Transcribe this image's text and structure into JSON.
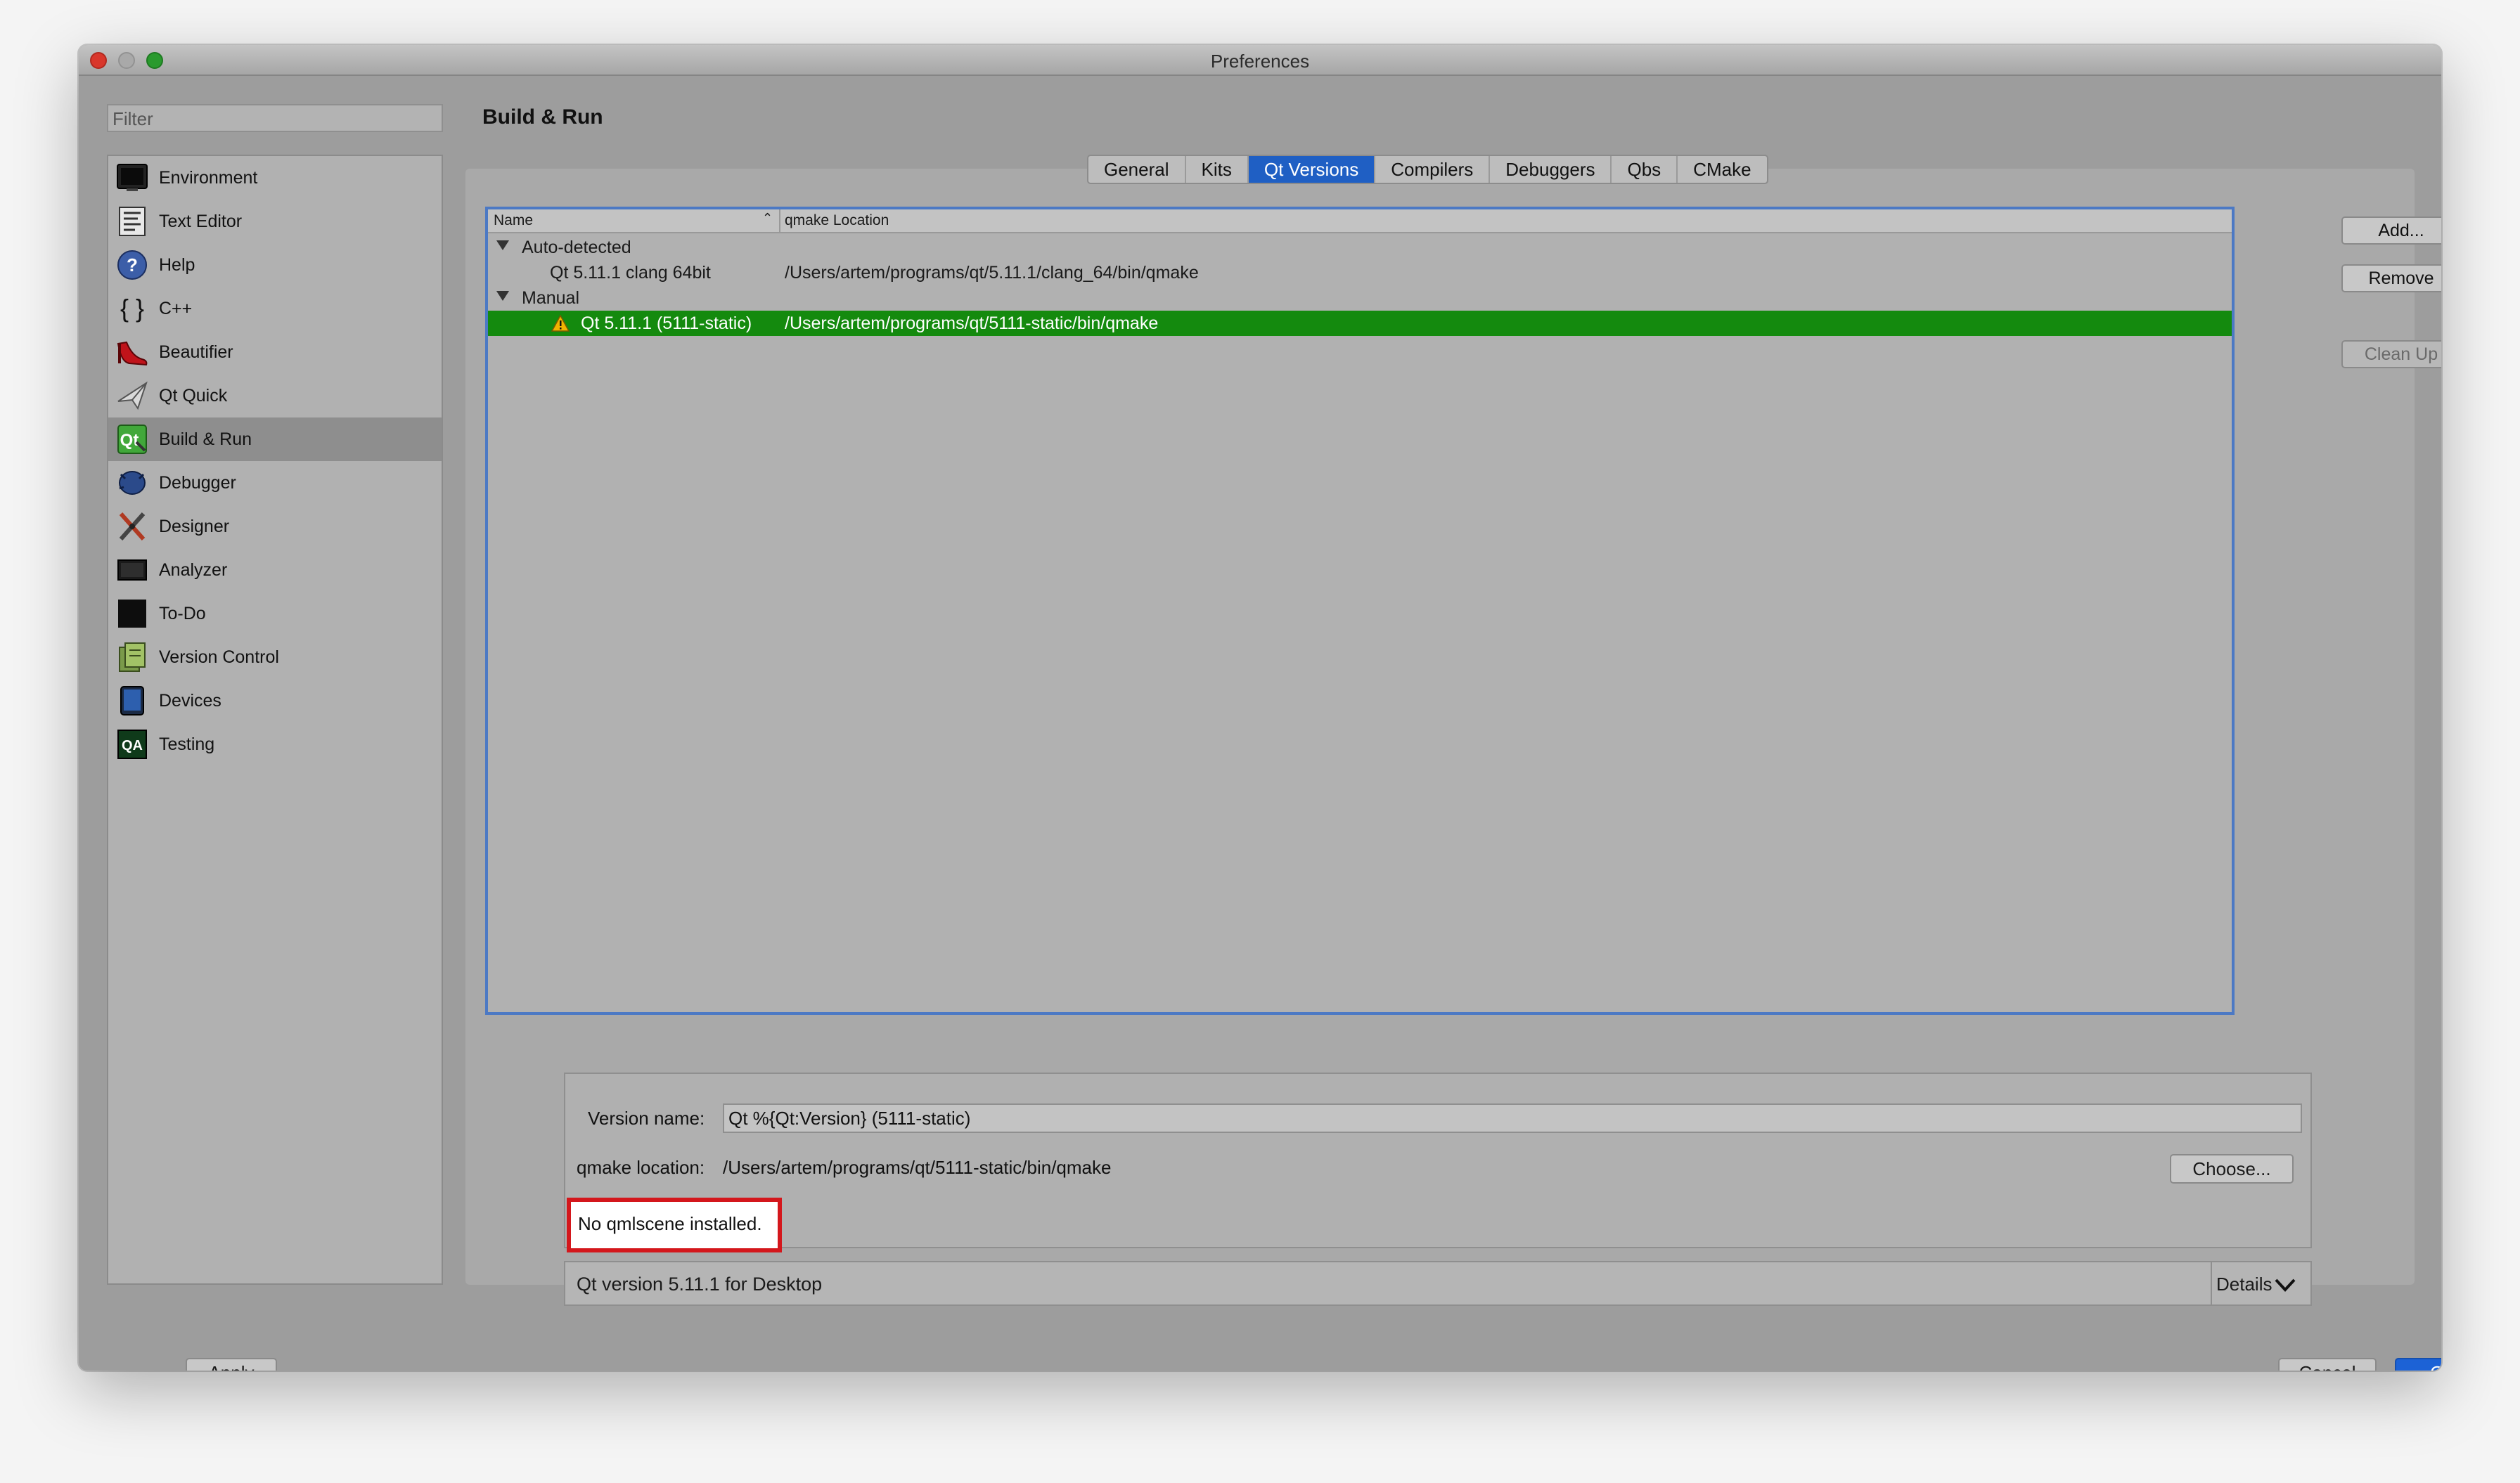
{
  "window": {
    "title": "Preferences"
  },
  "filter": {
    "placeholder": "Filter"
  },
  "sidebar": {
    "items": [
      {
        "label": "Environment",
        "icon": "environment-icon"
      },
      {
        "label": "Text Editor",
        "icon": "text-editor-icon"
      },
      {
        "label": "Help",
        "icon": "help-icon"
      },
      {
        "label": "C++",
        "icon": "cpp-braces-icon"
      },
      {
        "label": "Beautifier",
        "icon": "beautifier-shoe-icon"
      },
      {
        "label": "Qt Quick",
        "icon": "qt-quick-icon"
      },
      {
        "label": "Build & Run",
        "icon": "build-run-icon",
        "selected": true
      },
      {
        "label": "Debugger",
        "icon": "debugger-icon"
      },
      {
        "label": "Designer",
        "icon": "designer-icon"
      },
      {
        "label": "Analyzer",
        "icon": "analyzer-icon"
      },
      {
        "label": "To-Do",
        "icon": "todo-icon"
      },
      {
        "label": "Version Control",
        "icon": "version-control-icon"
      },
      {
        "label": "Devices",
        "icon": "devices-icon"
      },
      {
        "label": "Testing",
        "icon": "testing-qa-icon"
      }
    ]
  },
  "page": {
    "title": "Build & Run"
  },
  "tabs": [
    {
      "label": "General"
    },
    {
      "label": "Kits"
    },
    {
      "label": "Qt Versions",
      "active": true
    },
    {
      "label": "Compilers"
    },
    {
      "label": "Debuggers"
    },
    {
      "label": "Qbs"
    },
    {
      "label": "CMake"
    }
  ],
  "tree": {
    "headers": {
      "name": "Name",
      "location": "qmake Location"
    },
    "groups": [
      {
        "label": "Auto-detected",
        "rows": [
          {
            "name": "Qt 5.11.1 clang 64bit",
            "location": "/Users/artem/programs/qt/5.11.1/clang_64/bin/qmake"
          }
        ]
      },
      {
        "label": "Manual",
        "rows": [
          {
            "name": "Qt 5.11.1 (5111-static)",
            "location": "/Users/artem/programs/qt/5111-static/bin/qmake",
            "selected": true,
            "warning": true
          }
        ]
      }
    ]
  },
  "buttons": {
    "add": "Add...",
    "remove": "Remove",
    "cleanup": "Clean Up",
    "choose": "Choose...",
    "apply": "Apply",
    "cancel": "Cancel",
    "ok": "OK"
  },
  "details": {
    "version_name_label": "Version name:",
    "version_name_value": "Qt %{Qt:Version} (5111-static)",
    "qmake_location_label": "qmake location:",
    "qmake_location_value": "/Users/artem/programs/qt/5111-static/bin/qmake",
    "warning": "No qmlscene installed."
  },
  "summary": {
    "text": "Qt version 5.11.1 for Desktop",
    "details_label": "Details"
  },
  "colors": {
    "selection_green": "#148a0e",
    "accent_blue": "#1f5fc4",
    "warning_red": "#d4171c"
  }
}
